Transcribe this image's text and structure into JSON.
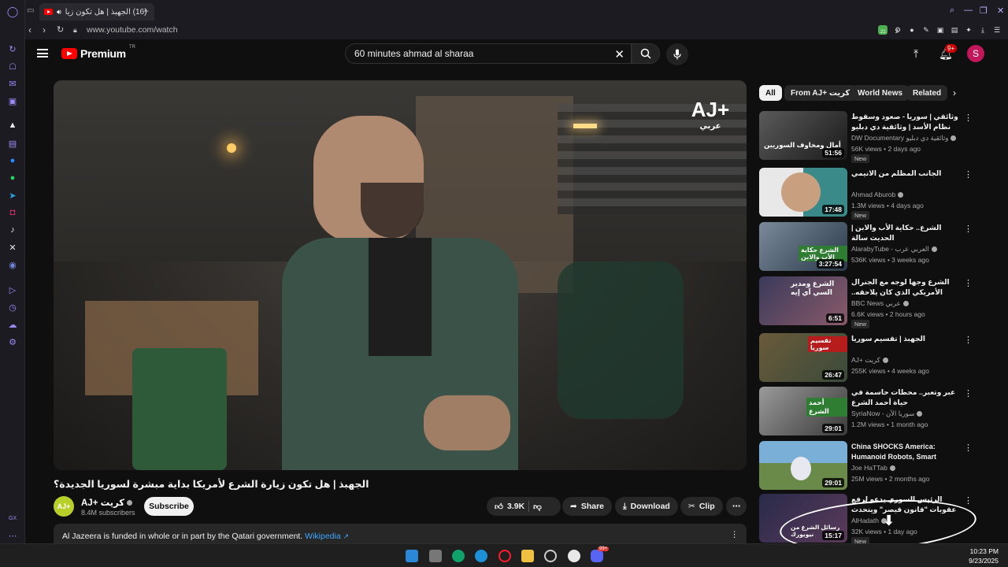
{
  "browser": {
    "tab_title": "(16) الجهبذ | هل تكون زيا",
    "url": "www.youtube.com/watch",
    "ext_badge_1": "21",
    "ext_badge_2": "2"
  },
  "header": {
    "logo_text": "Premium",
    "logo_super": "TR",
    "search_value": "60 minutes ahmad al sharaa",
    "notif_count": "9+",
    "avatar_letter": "S"
  },
  "video": {
    "overlay_logo": "AJ+",
    "overlay_logo_sub": "عربي",
    "title": "الجهبذ | هل تكون زيارة الشرع لأمريكا بداية مبشرة لسوريا الجديدة؟",
    "channel": "AJ+ كريت",
    "channel_avatar_text": "AJ+",
    "subscribers": "8.4M subscribers",
    "subscribe_label": "Subscribe",
    "likes": "3.9K",
    "share_label": "Share",
    "download_label": "Download",
    "clip_label": "Clip",
    "more_label": "⋯",
    "desc_text": "Al Jazeera is funded in whole or in part by the Qatari government.",
    "desc_link": "Wikipedia"
  },
  "chips": [
    "All",
    "From AJ+ كريت",
    "World News",
    "Related"
  ],
  "recommendations": [
    {
      "title": "وثائقي | سوريا - صعود وسقوط نظام الأسد | وثائقية دي دبليو",
      "channel": "DW Documentary وثائقية دي دبليو",
      "meta": "56K views • 2 days ago",
      "duration": "51:56",
      "badge": "New",
      "thumb_text": "أمال ومخاوف السوريين"
    },
    {
      "title": "الجانب المظلم من الانيمي",
      "channel": "Ahmad Aburob",
      "meta": "1.3M views • 4 days ago",
      "duration": "17:48",
      "badge": "New",
      "thumb_text": ""
    },
    {
      "title": "الشرع.. حكاية الأب والابن | الحديث سالة",
      "channel": "AlarabyTube - العربي عرب",
      "meta": "536K views • 3 weeks ago",
      "duration": "3:27:54",
      "badge": "",
      "thumb_text": "الشرع حكاية الأب والابن"
    },
    {
      "title": "الشرع وجها لوجه مع الجنرال الأمريكي الذي كان يلاحقه.. الرئيس السوري يجيبه كيف ...",
      "channel": "BBC News عربي",
      "meta": "6.6K views • 2 hours ago",
      "duration": "6:51",
      "badge": "New",
      "thumb_text": "الشرع ومدير السي آي إيه"
    },
    {
      "title": "الجهبذ | تقسيم سوريا",
      "channel": "AJ+ كريت",
      "meta": "255K views • 4 weeks ago",
      "duration": "26:47",
      "badge": "",
      "thumb_text": "تقسيم سوريا"
    },
    {
      "title": "عبر وتعبر.. محطات حاسمة في حياة أحمد الشرع",
      "channel": "SyriaNow - سوريا الآن",
      "meta": "1.2M views • 1 month ago",
      "duration": "29:01",
      "badge": "",
      "thumb_text": "أحمد الشرع"
    },
    {
      "title": "China SHOCKS America: Humanoid Robots, Smart Citie...",
      "channel": "Joe HaTTab",
      "meta": "25M views • 2 months ago",
      "duration": "29:01",
      "badge": "",
      "thumb_text": ""
    },
    {
      "title": "الرئيس السوري يدعو لرفع عقوبات \"قانون قيصر\" ويتحدث عن بنود مخاوف ...",
      "channel": "AlHadath",
      "meta": "32K views • 1 day ago",
      "duration": "15:17",
      "badge": "New",
      "thumb_text": "رسائل الشرع من نيويورك"
    }
  ],
  "taskbar": {
    "time": "10:23 PM",
    "date": "9/23/2025",
    "badge": "99+"
  },
  "colors": {
    "yt_red": "#ff0000",
    "accent_link": "#3ea6ff",
    "bg": "#0f0f0f",
    "chip_bg": "#272727",
    "opera_accent": "#9a8cf5"
  }
}
